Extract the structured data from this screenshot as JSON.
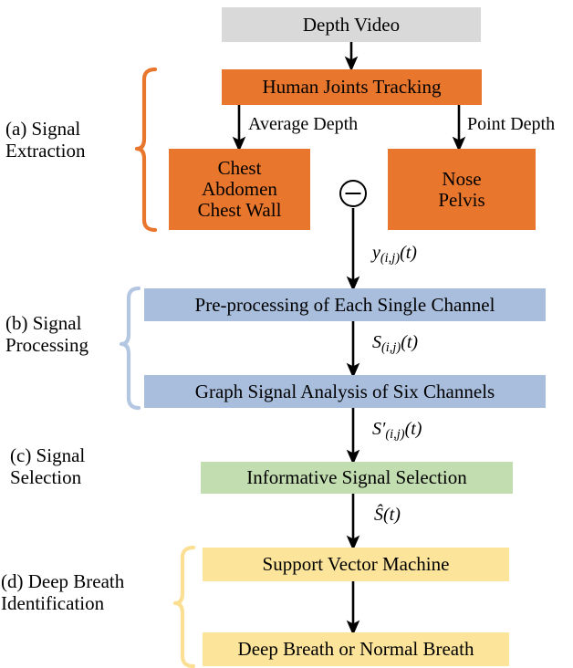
{
  "figure": {
    "title": "Deep Breath Identification Pipeline Flowchart",
    "colors": {
      "input": "#d9d9d9",
      "extraction": "#e8762c",
      "processing": "#a9bedd",
      "selection": "#c2ddb0",
      "identification": "#fce49a",
      "arrow": "#000000"
    }
  },
  "stages": [
    {
      "id": "a",
      "label": "(a) Signal\nExtraction",
      "brace_color": "#e8762c"
    },
    {
      "id": "b",
      "label": "(b) Signal\nProcessing",
      "brace_color": "#a9bedd"
    },
    {
      "id": "c",
      "label": "(c) Signal\nSelection",
      "brace_color": "#c2ddb0"
    },
    {
      "id": "d",
      "label": "(d) Deep Breath\n  Identification",
      "brace_color": "#fce49a"
    }
  ],
  "nodes": [
    {
      "id": "depth_video",
      "label": "Depth Video",
      "color": "#d9d9d9"
    },
    {
      "id": "joints_tracking",
      "label": "Human Joints Tracking",
      "color": "#e8762c"
    },
    {
      "id": "chest_group",
      "label": "Chest\nAbdomen\nChest Wall",
      "color": "#e8762c"
    },
    {
      "id": "nose_pelvis",
      "label": "Nose\nPelvis",
      "color": "#e8762c"
    },
    {
      "id": "preprocessing",
      "label": "Pre-processing of Each Single Channel",
      "color": "#a9bedd"
    },
    {
      "id": "graph_analysis",
      "label": "Graph Signal Analysis of Six Channels",
      "color": "#a9bedd"
    },
    {
      "id": "signal_selection",
      "label": "Informative Signal Selection",
      "color": "#c2ddb0"
    },
    {
      "id": "svm",
      "label": "Support Vector Machine",
      "color": "#fce49a"
    },
    {
      "id": "result",
      "label": "Deep Breath or Normal Breath",
      "color": "#fce49a"
    }
  ],
  "edge_labels": {
    "average_depth": "Average Depth",
    "point_depth": "Point Depth"
  },
  "math_labels": {
    "y_signal": {
      "base": "y",
      "sub": "(i,j)",
      "arg": "(t)",
      "prime": ""
    },
    "s_signal": {
      "base": "S",
      "sub": "(i,j)",
      "arg": "(t)",
      "prime": ""
    },
    "s_prime": {
      "base": "S",
      "sub": "(i,j)",
      "arg": "(t)",
      "prime": "′"
    },
    "s_hat": {
      "base": "Ŝ",
      "sub": "",
      "arg": "(t)",
      "prime": ""
    }
  },
  "operators": [
    {
      "id": "subtract",
      "symbol": "−",
      "name": "minus-operator"
    }
  ]
}
